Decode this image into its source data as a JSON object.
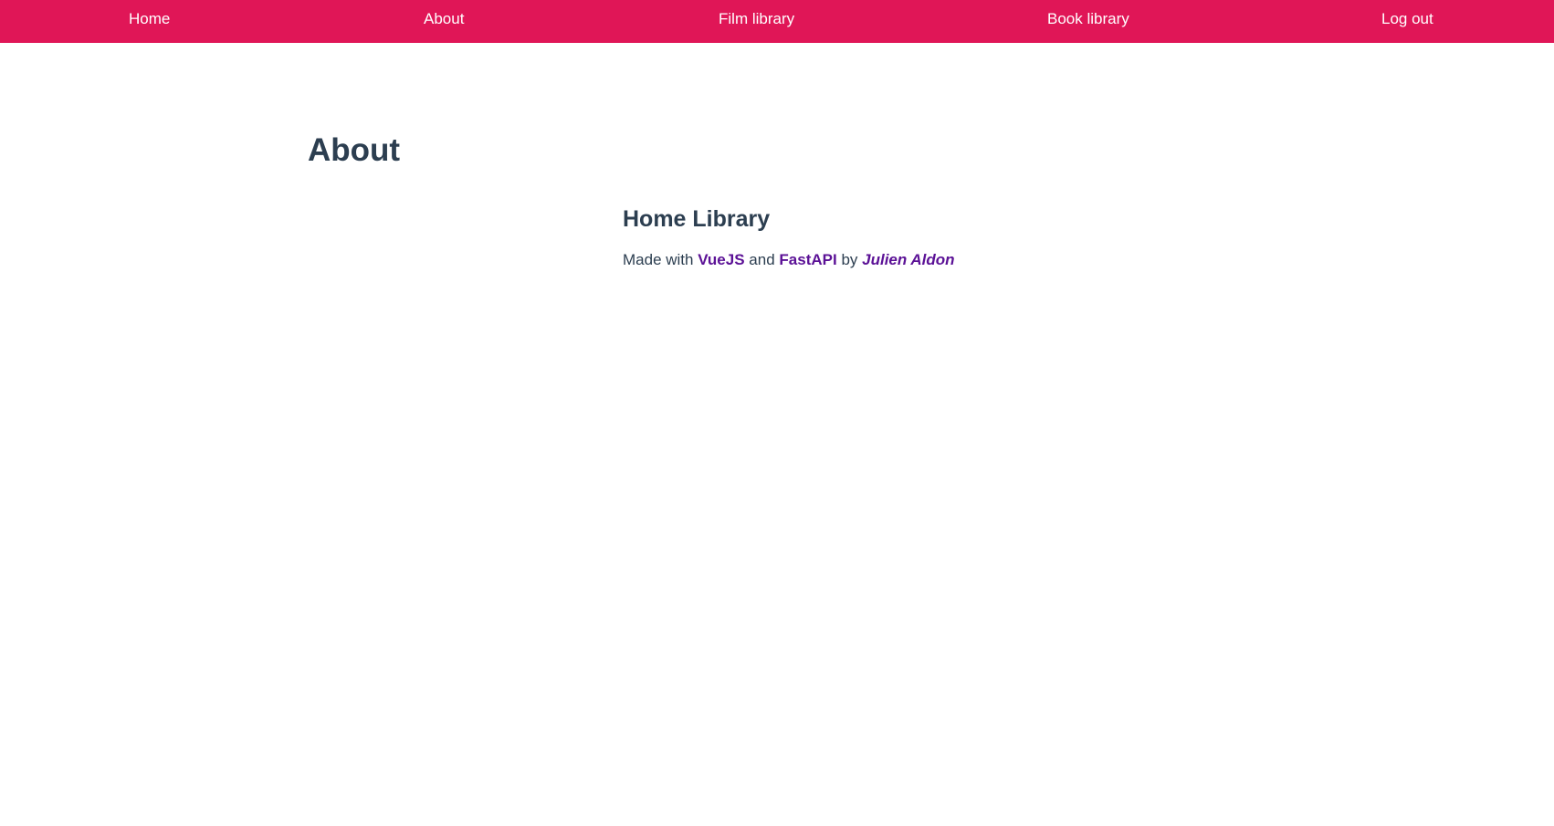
{
  "theme": {
    "nav_background": "#e01657",
    "nav_text": "#ffffff",
    "text_color": "#2c3e50",
    "link_color": "#5b1196"
  },
  "nav": {
    "items": [
      {
        "label": "Home"
      },
      {
        "label": "About"
      },
      {
        "label": "Film library"
      },
      {
        "label": "Book library"
      },
      {
        "label": "Log out"
      }
    ]
  },
  "page": {
    "title": "About"
  },
  "about": {
    "heading": "Home Library",
    "made_with": "Made with",
    "tech1": "VueJS",
    "and": "and",
    "tech2": "FastAPI",
    "by": "by",
    "author": "Julien Aldon"
  }
}
